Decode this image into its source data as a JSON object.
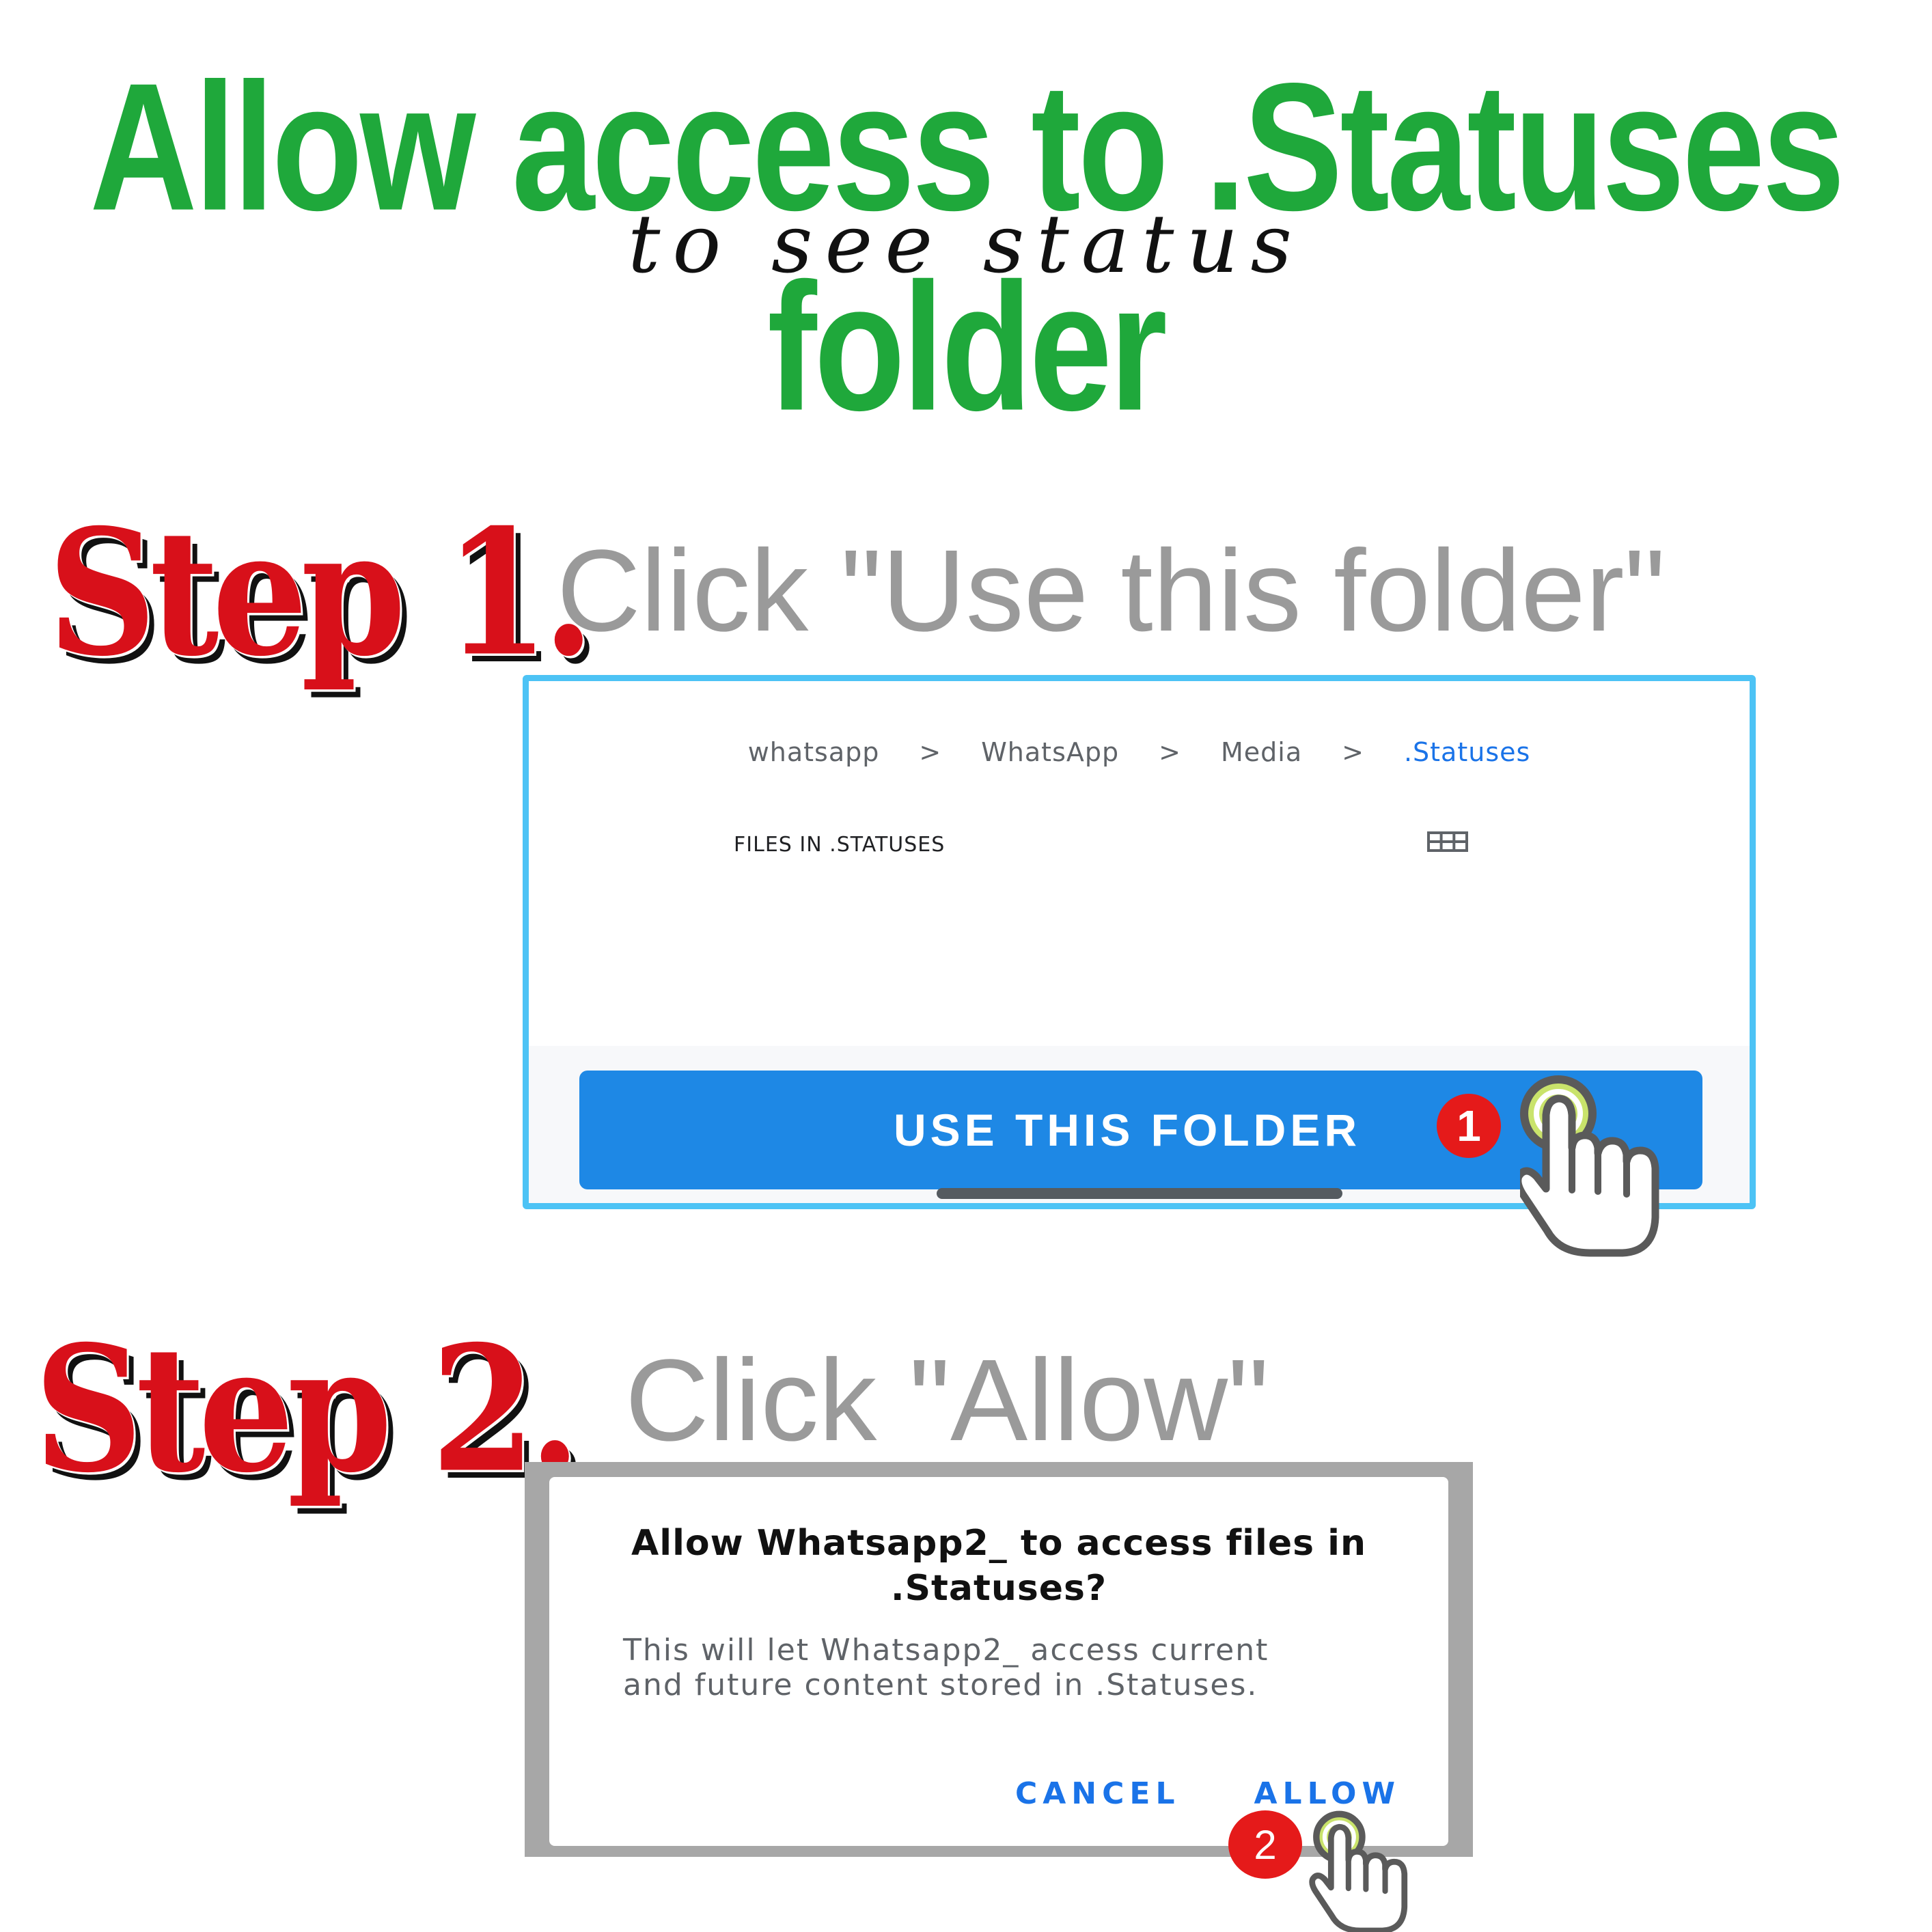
{
  "header": {
    "title": "Allow access to .Statuses folder",
    "subtitle": "to see status"
  },
  "step1": {
    "label": "Step 1.",
    "instruction": "Click \"Use this folder\"",
    "breadcrumb": [
      "whatsapp",
      "WhatsApp",
      "Media",
      ".Statuses"
    ],
    "breadcrumb_separator": ">",
    "files_header": "FILES IN .STATUSES",
    "button_label": "USE THIS FOLDER",
    "badge": "1",
    "accent_color": "#1e88e5",
    "frame_color": "#4dc3f5"
  },
  "step2": {
    "label": "Step 2.",
    "instruction": "Click \"Allow\"",
    "dialog": {
      "title": "Allow Whatsapp2_ to access files in .Statuses?",
      "body": "This will let Whatsapp2_ access current and future content stored in .Statuses.",
      "cancel_label": "CANCEL",
      "allow_label": "ALLOW"
    },
    "badge": "2"
  },
  "colors": {
    "title_green": "#1fa83b",
    "step_red": "#d8101a",
    "instruction_gray": "#9a9a9a",
    "link_blue": "#1a73e8"
  },
  "icons": [
    "grid-view-icon",
    "tap-hand-icon"
  ]
}
